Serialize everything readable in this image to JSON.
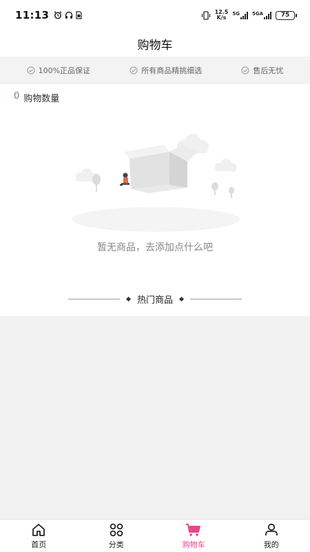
{
  "status_bar": {
    "time": "11:13",
    "net_speed_value": "12.5",
    "net_speed_unit": "K/s",
    "signal_1_label": "5G",
    "signal_2_label": "5GA",
    "battery": "75"
  },
  "header": {
    "title": "购物车"
  },
  "guarantees": [
    {
      "label": "100%正品保证",
      "icon": "check-circle-icon"
    },
    {
      "label": "所有商品精挑细选",
      "icon": "check-circle-icon"
    },
    {
      "label": "售后无忧",
      "icon": "check-circle-icon"
    }
  ],
  "cart": {
    "count": "0",
    "count_label": "购物数量"
  },
  "empty_state": {
    "message": "暂无商品，去添加点什么吧"
  },
  "hot_section": {
    "label": "热门商品"
  },
  "tabbar": {
    "active_color": "#e8458c",
    "items": [
      {
        "label": "首页",
        "icon": "home-icon"
      },
      {
        "label": "分类",
        "icon": "grid-icon"
      },
      {
        "label": "购物车",
        "icon": "cart-icon"
      },
      {
        "label": "我的",
        "icon": "user-icon"
      }
    ]
  }
}
